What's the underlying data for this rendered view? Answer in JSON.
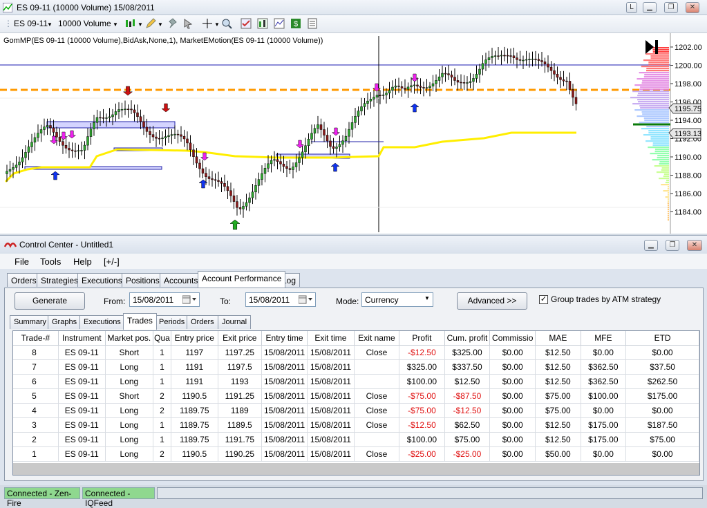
{
  "chart_window": {
    "title": "ES 09-11 (10000 Volume)  15/08/2011",
    "toolbar": {
      "instrument": "ES 09-11",
      "period": "10000 Volume"
    },
    "indicator_line": "GomMP(ES 09-11 (10000 Volume),BidAsk,None,1), MarketEMotion(ES 09-11 (10000 Volume))",
    "price_labels": [
      "1202.00",
      "1200.00",
      "1198.00",
      "1196.00",
      "1194.00",
      "1192.00",
      "1190.00",
      "1188.00",
      "1186.00",
      "1184.00"
    ],
    "current_price": "1195.75",
    "marker_price": "1193.13",
    "colors": {
      "orange_line": "#ff9a00",
      "yellow_line": "#ffee00",
      "blue_line": "#1a1ab0"
    }
  },
  "control_center": {
    "title": "Control Center - Untitled1",
    "menu": [
      "File",
      "Tools",
      "Help",
      "[+/-]"
    ],
    "main_tabs": [
      "Orders",
      "Strategies",
      "Executions",
      "Positions",
      "Accounts",
      "Account Performance",
      "Log"
    ],
    "active_main_tab": "Account Performance",
    "generate_label": "Generate",
    "from_label": "From:",
    "from_value": "15/08/2011",
    "to_label": "To:",
    "to_value": "15/08/2011",
    "mode_label": "Mode:",
    "mode_value": "Currency",
    "advanced_label": "Advanced >>",
    "group_label": "Group trades by ATM strategy",
    "sub_tabs": [
      "Summary",
      "Graphs",
      "Executions",
      "Trades",
      "Periods",
      "Orders",
      "Journal"
    ],
    "active_sub_tab": "Trades",
    "columns": [
      "Trade-#",
      "Instrument",
      "Market pos.",
      "Qua",
      "Entry price",
      "Exit price",
      "Entry time",
      "Exit time",
      "Exit name",
      "Profit",
      "Cum. profit",
      "Commissio",
      "MAE",
      "MFE",
      "ETD"
    ],
    "rows": [
      [
        "8",
        "ES 09-11",
        "Short",
        "1",
        "1197",
        "1197.25",
        "15/08/2011",
        "15/08/2011",
        "Close",
        "-$12.50",
        "$325.00",
        "$0.00",
        "$12.50",
        "$0.00",
        "$0.00"
      ],
      [
        "7",
        "ES 09-11",
        "Long",
        "1",
        "1191",
        "1197.5",
        "15/08/2011",
        "15/08/2011",
        "",
        "$325.00",
        "$337.50",
        "$0.00",
        "$12.50",
        "$362.50",
        "$37.50"
      ],
      [
        "6",
        "ES 09-11",
        "Long",
        "1",
        "1191",
        "1193",
        "15/08/2011",
        "15/08/2011",
        "",
        "$100.00",
        "$12.50",
        "$0.00",
        "$12.50",
        "$362.50",
        "$262.50"
      ],
      [
        "5",
        "ES 09-11",
        "Short",
        "2",
        "1190.5",
        "1191.25",
        "15/08/2011",
        "15/08/2011",
        "Close",
        "-$75.00",
        "-$87.50",
        "$0.00",
        "$75.00",
        "$100.00",
        "$175.00"
      ],
      [
        "4",
        "ES 09-11",
        "Long",
        "2",
        "1189.75",
        "1189",
        "15/08/2011",
        "15/08/2011",
        "Close",
        "-$75.00",
        "-$12.50",
        "$0.00",
        "$75.00",
        "$0.00",
        "$0.00"
      ],
      [
        "3",
        "ES 09-11",
        "Long",
        "1",
        "1189.75",
        "1189.5",
        "15/08/2011",
        "15/08/2011",
        "Close",
        "-$12.50",
        "$62.50",
        "$0.00",
        "$12.50",
        "$175.00",
        "$187.50"
      ],
      [
        "2",
        "ES 09-11",
        "Long",
        "1",
        "1189.75",
        "1191.75",
        "15/08/2011",
        "15/08/2011",
        "",
        "$100.00",
        "$75.00",
        "$0.00",
        "$12.50",
        "$175.00",
        "$75.00"
      ],
      [
        "1",
        "ES 09-11",
        "Long",
        "2",
        "1190.5",
        "1190.25",
        "15/08/2011",
        "15/08/2011",
        "Close",
        "-$25.00",
        "-$25.00",
        "$0.00",
        "$50.00",
        "$0.00",
        "$0.00"
      ]
    ]
  },
  "status": {
    "conn1": "Connected - Zen-Fire",
    "conn2": "Connected - IQFeed"
  }
}
